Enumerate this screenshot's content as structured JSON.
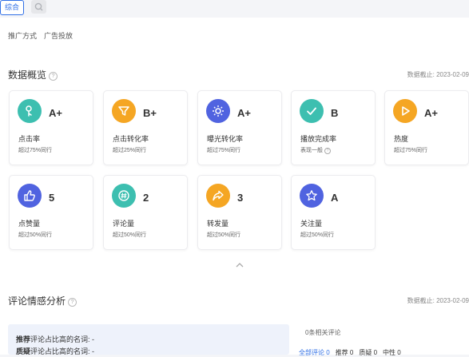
{
  "tabs": {
    "active_label": "综合",
    "search_icon": "search-icon"
  },
  "breadcrumb": {
    "label": "推广方式",
    "value": "广告投放"
  },
  "overview": {
    "title": "数据概览",
    "date": "数据截止: 2023-02-09"
  },
  "cards": [
    {
      "label": "点击率",
      "grade": "A+",
      "sub": "超过75%同行",
      "color": "#3dbfb0",
      "icon": "touch-icon"
    },
    {
      "label": "点击转化率",
      "grade": "B+",
      "sub": "超过25%同行",
      "color": "#f5a623",
      "icon": "funnel-icon"
    },
    {
      "label": "曝光转化率",
      "grade": "A+",
      "sub": "超过75%同行",
      "color": "#5063e0",
      "icon": "sun-icon"
    },
    {
      "label": "播放完成率",
      "grade": "B",
      "sub": "表现一般",
      "color": "#3dbfb0",
      "icon": "check-icon"
    },
    {
      "label": "热度",
      "grade": "A+",
      "sub": "超过75%同行",
      "color": "#f5a623",
      "icon": "play-icon"
    },
    {
      "label": "点赞量",
      "grade": "5",
      "sub": "超过50%同行",
      "color": "#5063e0",
      "icon": "thumbs-up-icon"
    },
    {
      "label": "评论量",
      "grade": "2",
      "sub": "超过50%同行",
      "color": "#3dbfb0",
      "icon": "comment-hash-icon"
    },
    {
      "label": "转发量",
      "grade": "3",
      "sub": "超过50%同行",
      "color": "#f5a623",
      "icon": "share-icon"
    },
    {
      "label": "关注量",
      "grade": "A",
      "sub": "超过50%同行",
      "color": "#5063e0",
      "icon": "star-icon"
    }
  ],
  "sentiment": {
    "title": "评论情感分析",
    "date": "数据截止: 2023-02-09",
    "line1_bold": "推荐",
    "line1_rest": "评论占比高的名词: -",
    "line2_bold": "质疑",
    "line2_rest": "评论占比高的名词: -",
    "related": "0条相关评论",
    "filters": [
      "全部评论 0",
      "推荐 0",
      "质疑 0",
      "中性 0"
    ]
  }
}
